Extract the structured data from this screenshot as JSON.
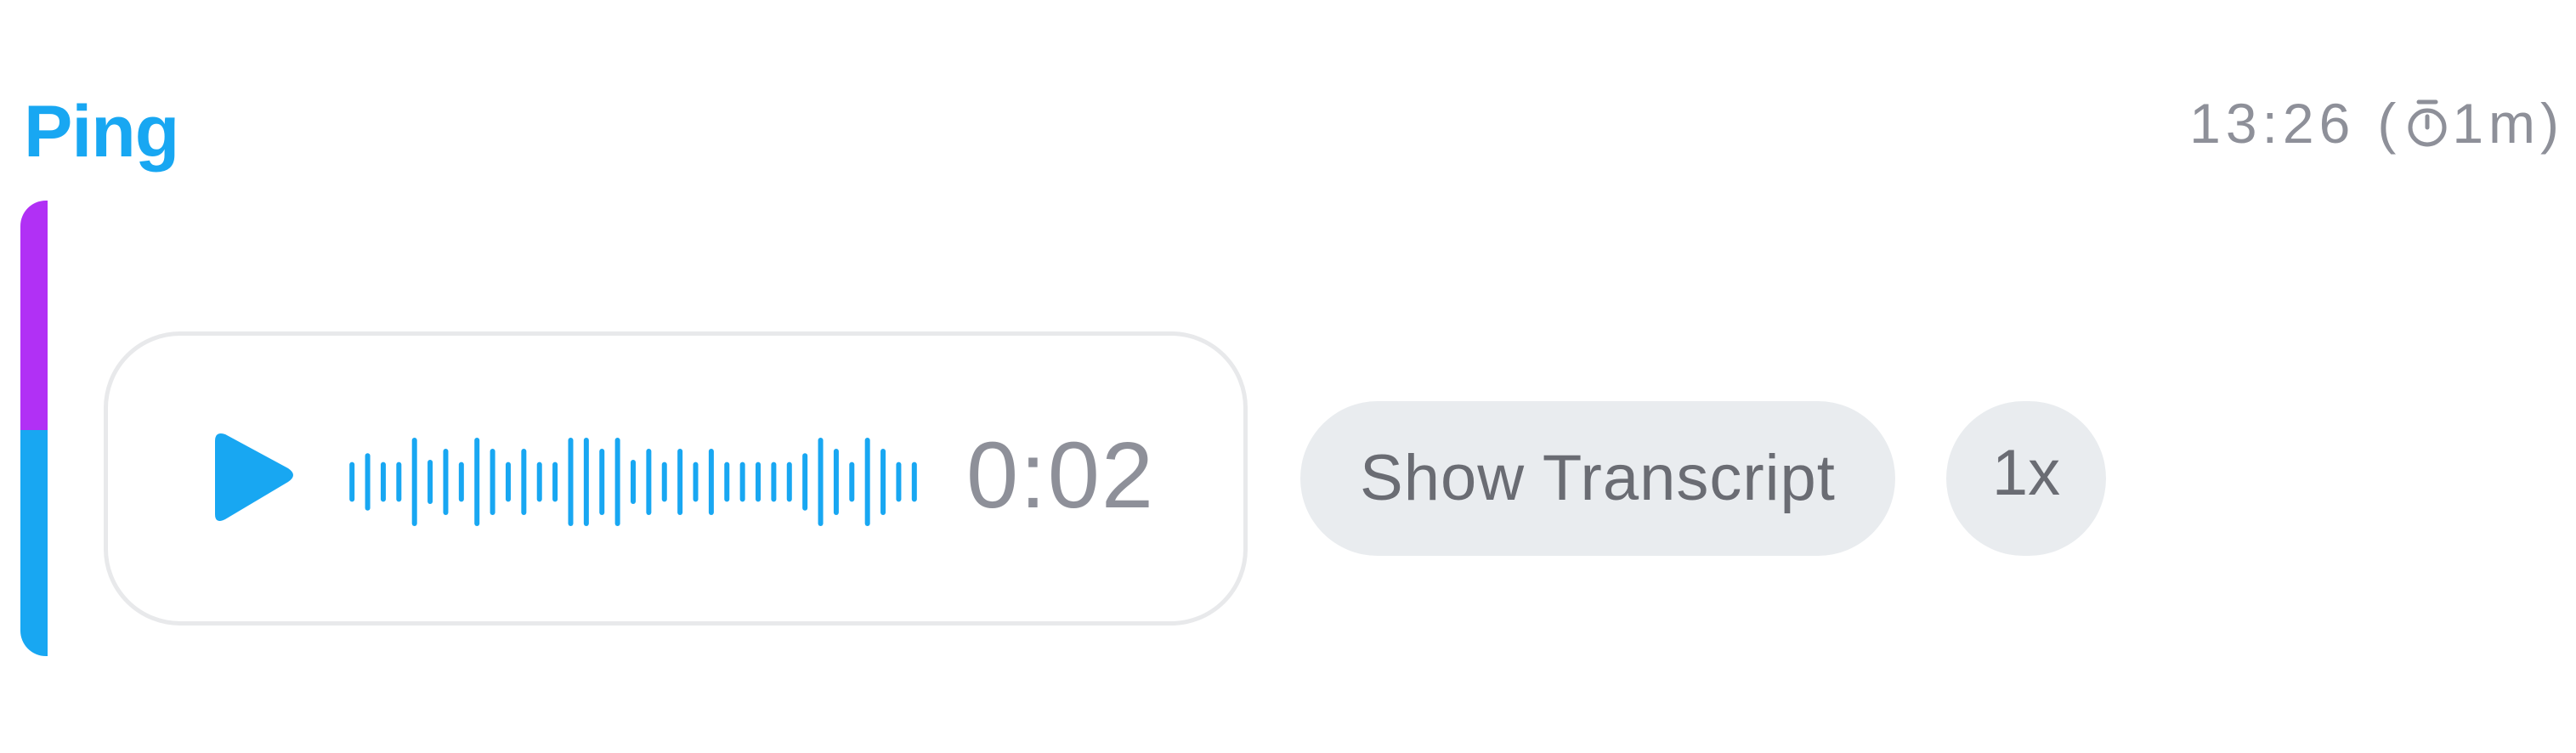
{
  "message": {
    "sender": "Ping",
    "time": "13:26",
    "duration_note": "1m",
    "open_paren": "(",
    "close_paren": ")"
  },
  "voice_note": {
    "duration": "0:02",
    "play_icon": "play-icon",
    "waveform_levels": [
      0.45,
      0.65,
      0.45,
      0.45,
      1.0,
      0.5,
      0.75,
      0.45,
      1.0,
      0.75,
      0.45,
      0.75,
      0.45,
      0.45,
      1.0,
      1.0,
      0.75,
      1.0,
      0.5,
      0.75,
      0.45,
      0.75,
      0.45,
      0.75,
      0.45,
      0.45,
      0.45,
      0.45,
      0.45,
      0.65,
      1.0,
      0.75,
      0.45,
      1.0,
      0.75,
      0.45,
      0.45
    ]
  },
  "controls": {
    "transcript_label": "Show Transcript",
    "speed_label": "1x"
  },
  "colors": {
    "accent_blue": "#18a7f2",
    "accent_purple": "#b130f5",
    "muted_text": "#8e9099",
    "button_bg": "#e9ecef",
    "card_border": "#e8e9eb"
  }
}
